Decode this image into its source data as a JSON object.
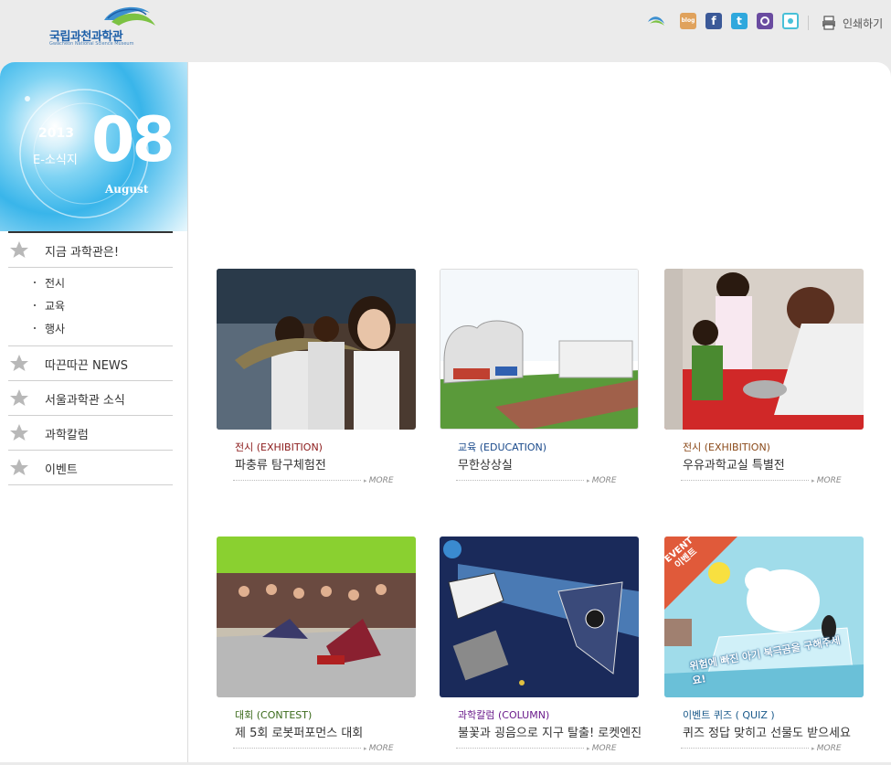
{
  "header": {
    "logo_text": "국립과천과학관",
    "logo_sub": "Gwacheon National Science Museum",
    "icons": [
      {
        "name": "museum-icon",
        "bg": "transparent",
        "glyph": ""
      },
      {
        "name": "blog-icon",
        "bg": "#e0a25c",
        "glyph": "blog"
      },
      {
        "name": "facebook-icon",
        "bg": "#3b5998",
        "glyph": "f"
      },
      {
        "name": "twitter-icon",
        "bg": "#2fa8dd",
        "glyph": "t"
      },
      {
        "name": "chat-icon",
        "bg": "#6a4ba0",
        "glyph": ""
      },
      {
        "name": "me2day-icon",
        "bg": "#48c0d8",
        "glyph": ""
      }
    ],
    "print_label": "인쇄하기"
  },
  "banner": {
    "year": "2013",
    "subtitle": "E-소식지",
    "number": "08",
    "month": "August"
  },
  "nav": {
    "items": [
      {
        "label": "지금 과학관은!"
      },
      {
        "label": "따끈따끈 NEWS"
      },
      {
        "label": "서울과학관 소식"
      },
      {
        "label": "과학칼럼"
      },
      {
        "label": "이벤트"
      }
    ],
    "sub_items": [
      {
        "label": "전시"
      },
      {
        "label": "교육"
      },
      {
        "label": "행사"
      }
    ]
  },
  "cards": [
    {
      "category": "전시 (EXHIBITION)",
      "cat_color": "#8b1a1a",
      "title": "파충류 탐구체험전",
      "more": "MORE"
    },
    {
      "category": "교육 (EDUCATION)",
      "cat_color": "#1a4a8b",
      "title": "무한상상실",
      "more": "MORE"
    },
    {
      "category": "전시 (EXHIBITION)",
      "cat_color": "#8b4a1a",
      "title": "우유과학교실 특별전",
      "more": "MORE"
    },
    {
      "category": "대회 (CONTEST)",
      "cat_color": "#3a6a1a",
      "title": "제 5회 로봇퍼포먼스 대회",
      "more": "MORE"
    },
    {
      "category": "과학칼럼 (COLUMN)",
      "cat_color": "#6a1a8b",
      "title": "불꽃과 굉음으로 지구 탈출! 로켓엔진",
      "more": "MORE"
    },
    {
      "category": "이벤트 퀴즈 ( QUIZ )",
      "cat_color": "#1a5a8b",
      "title": "퀴즈 정답 맞히고 선물도 받으세요",
      "more": "MORE"
    }
  ],
  "event_badge": "EVENT\n이벤트",
  "event_caption": "위험에 빠진 아기 북극곰을 구해주세요!"
}
